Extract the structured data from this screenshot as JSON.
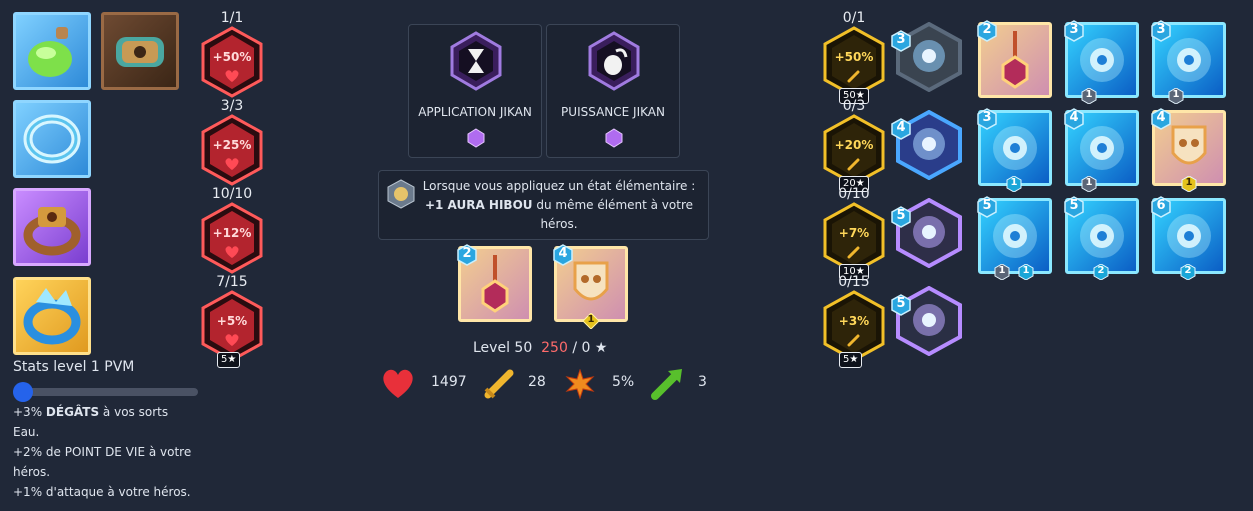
{
  "items": [
    {
      "name": "green-potion-item"
    },
    {
      "name": "bronze-cannon-item"
    },
    {
      "name": "ice-ring-item"
    },
    {
      "name": "bronze-gem-ring-item"
    },
    {
      "name": "crystal-ring-item"
    }
  ],
  "left_bonuses": [
    {
      "count": "1/1",
      "pct": "+50%",
      "icon": "heart-icon"
    },
    {
      "count": "3/3",
      "pct": "+25%",
      "icon": "heart-icon"
    },
    {
      "count": "10/10",
      "pct": "+12%",
      "icon": "heart-icon"
    },
    {
      "count": "7/15",
      "pct": "+5%",
      "icon": "heart-icon",
      "star_badge": "5★"
    }
  ],
  "stats_panel": {
    "title": "Stats level 1 PVM",
    "slider_value": 0,
    "line1_pre": "+3% ",
    "line1_bold": "DÉGÂTS",
    "line1_post": " à vos sorts",
    "line1_cont": "Eau.",
    "line2": "+2% de POINT DE VIE à votre",
    "line2_cont": "héros.",
    "line3": "+1% d'attaque à votre héros."
  },
  "abilities": [
    {
      "label": "APPLICATION JIKAN",
      "icon": "hourglass-crest-icon",
      "gem": "purple-gem-icon"
    },
    {
      "label": "PUISSANCE JIKAN",
      "icon": "hand-crest-icon",
      "gem": "purple-gem-icon"
    }
  ],
  "tooltip": {
    "line1": "Lorsque vous appliquez un état élémentaire :",
    "line2_bold": "+1 AURA HIBOU",
    "line2_rest": " du même élément à votre",
    "line3": "héros."
  },
  "center_cards": [
    {
      "level": "2",
      "icon": "pendant-shield-icon"
    },
    {
      "level": "4",
      "icon": "owl-shield-icon",
      "sub": "1"
    }
  ],
  "hero_stats": {
    "level_label": "Level 50",
    "stars_current": "250",
    "stars_sep": " / 0",
    "health": "1497",
    "attack": "28",
    "crit": "5%",
    "speed": "3",
    "colors": {
      "stars_current": "#ff6b6b"
    }
  },
  "right_bonuses": [
    {
      "count": "0/1",
      "pct": "+50%",
      "icon": "sword-icon",
      "star_badge": "50★"
    },
    {
      "count": "0/3",
      "pct": "+20%",
      "icon": "sword-icon",
      "star_badge": "20★"
    },
    {
      "count": "0/10",
      "pct": "+7%",
      "icon": "sword-icon",
      "star_badge": "10★"
    },
    {
      "count": "0/15",
      "pct": "+3%",
      "icon": "sword-icon",
      "star_badge": "5★"
    }
  ],
  "heroes": [
    {
      "level": "3",
      "name": "robot-hero"
    },
    {
      "level": "4",
      "name": "samurai-hero"
    },
    {
      "level": "5",
      "name": "goggle-hero"
    },
    {
      "level": "5",
      "name": "knight-hero"
    }
  ],
  "spell_grid": [
    {
      "level": "2",
      "style": "gold",
      "icon": "pendant-shield-icon"
    },
    {
      "level": "3",
      "style": "cyan",
      "icon": "water-trident-icon",
      "sub_left": "1"
    },
    {
      "level": "3",
      "style": "cyan",
      "icon": "water-drops-icon",
      "sub_left": "1"
    },
    {
      "level": "3",
      "style": "cyan",
      "icon": "water-vortex-icon",
      "sub": "1"
    },
    {
      "level": "4",
      "style": "cyan",
      "icon": "ice-crystal-icon",
      "sub_left": "1"
    },
    {
      "level": "4",
      "style": "gold",
      "icon": "owl-shield-icon",
      "sub_gold": "1"
    },
    {
      "level": "5",
      "style": "cyan",
      "icon": "water-wheel-icon",
      "sub_left": "1",
      "sub": "1"
    },
    {
      "level": "5",
      "style": "cyan",
      "icon": "water-gear-icon",
      "sub": "2"
    },
    {
      "level": "6",
      "style": "cyan",
      "icon": "water-clock-icon",
      "sub": "2"
    }
  ]
}
